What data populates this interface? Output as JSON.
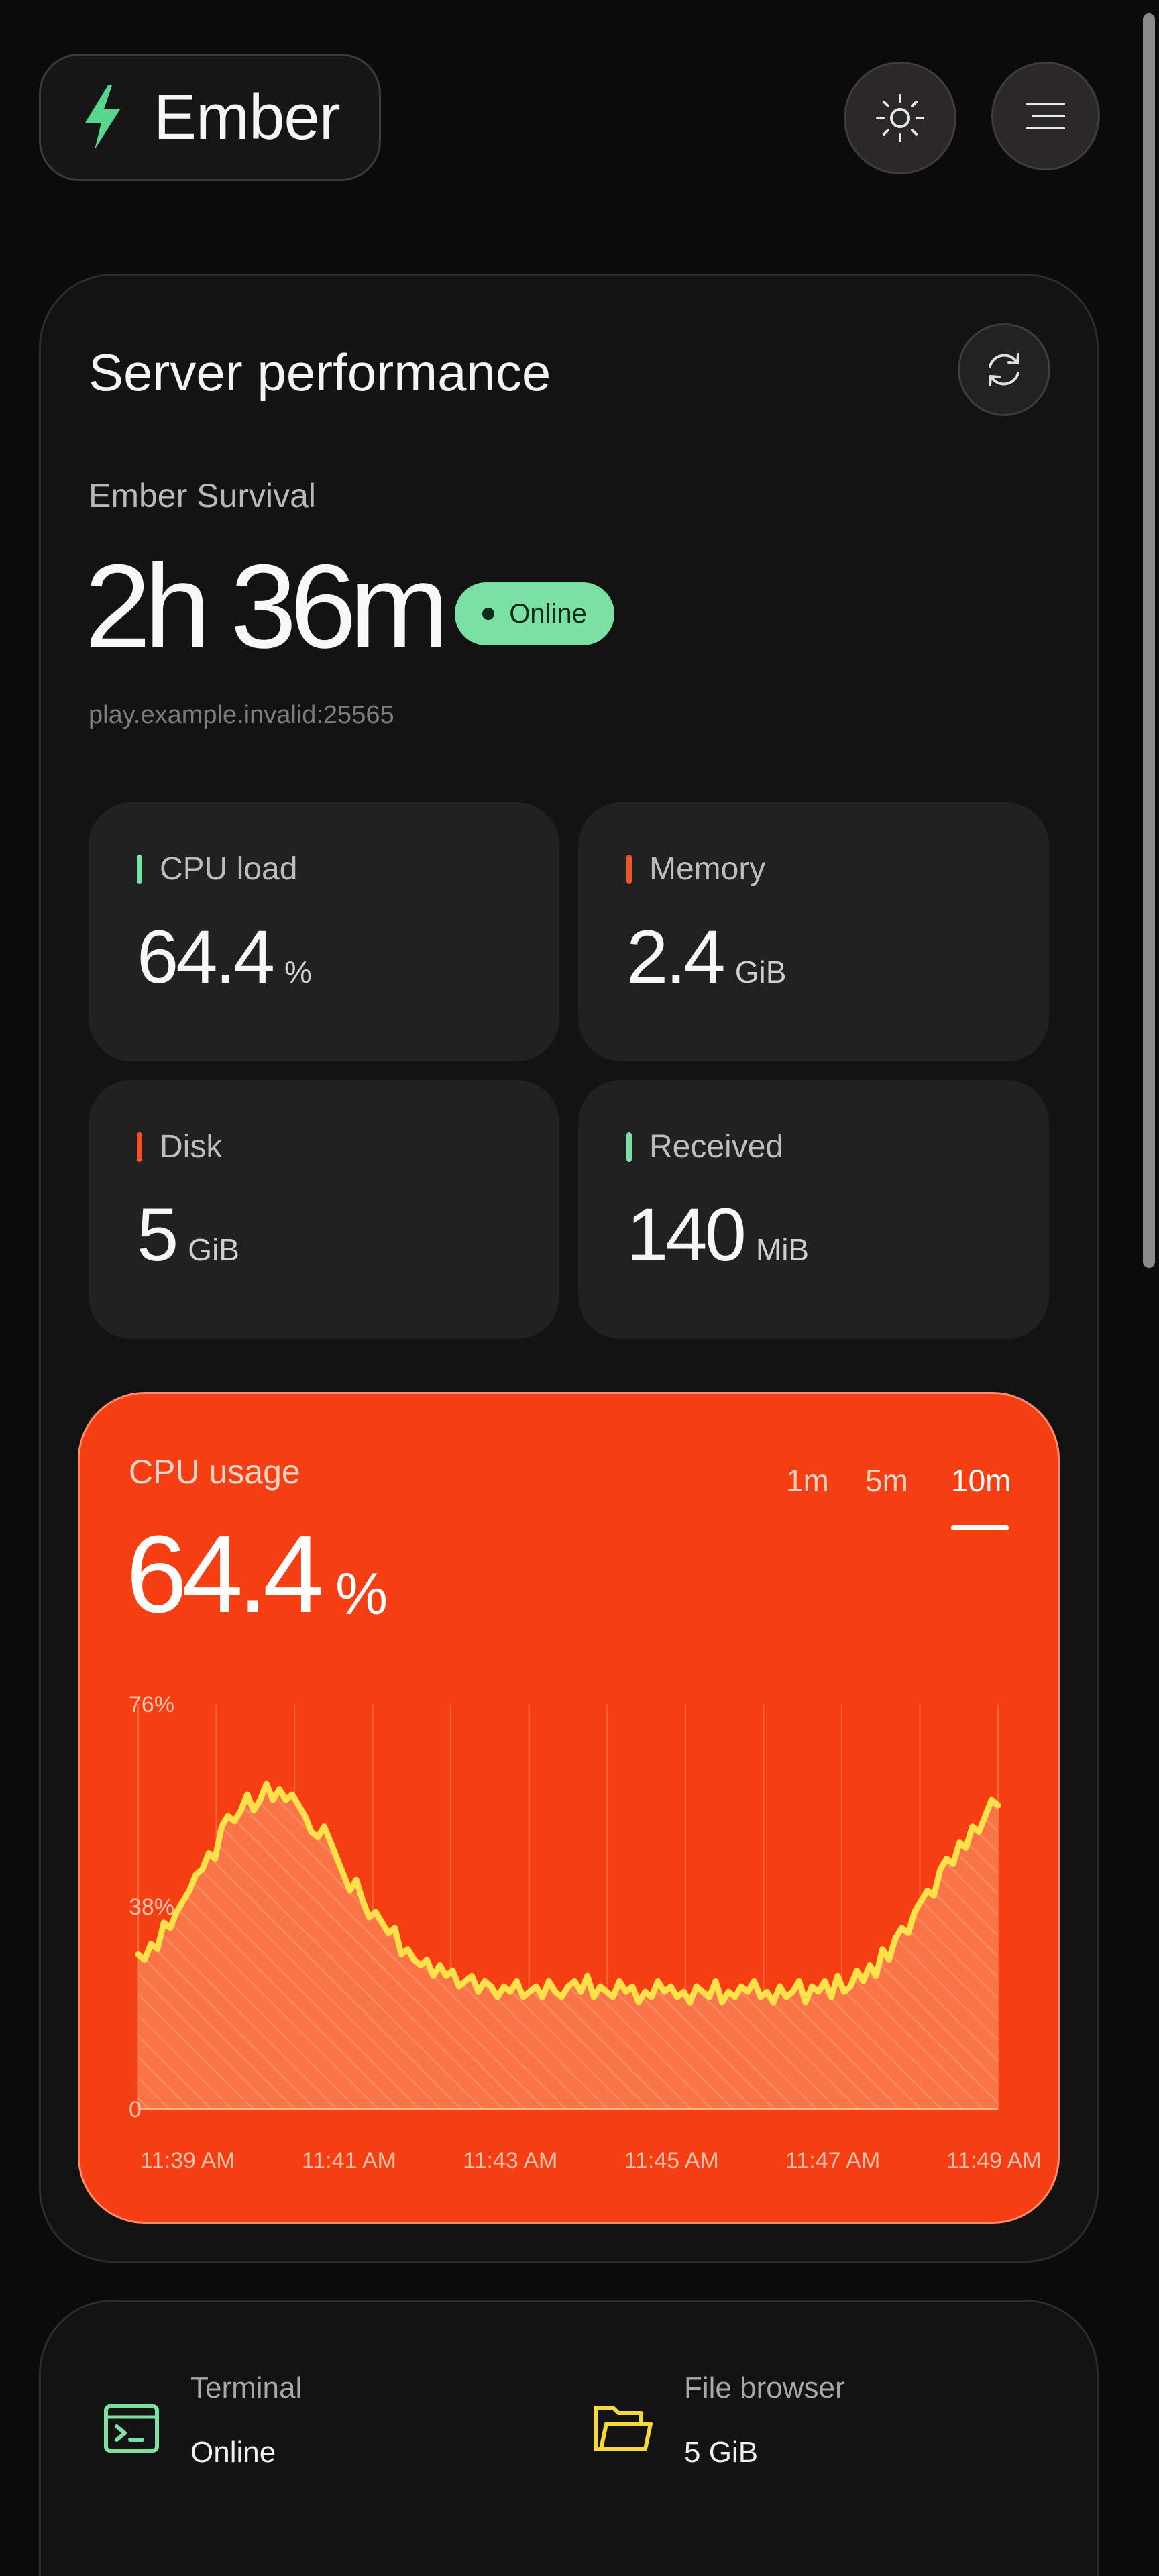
{
  "header": {
    "brand_name": "Ember",
    "theme_toggle_icon": "sun-icon",
    "menu_icon": "hamburger-icon"
  },
  "performance": {
    "title": "Server performance",
    "refresh_icon": "refresh-icon",
    "server_name": "Ember Survival",
    "uptime": "2h 36m",
    "status": "Online",
    "address": "play.example.invalid:25565",
    "stats": [
      {
        "label": "CPU load",
        "value": "64.4",
        "unit": "%",
        "accent": "#7ae0a3"
      },
      {
        "label": "Memory",
        "value": "2.4",
        "unit": "GiB",
        "accent": "#f0532a"
      },
      {
        "label": "Disk",
        "value": "5",
        "unit": "GiB",
        "accent": "#f0532a"
      },
      {
        "label": "Received",
        "value": "140",
        "unit": "MiB",
        "accent": "#7ae0a3"
      }
    ]
  },
  "cpu_chart": {
    "title": "CPU usage",
    "value": "64.4",
    "unit": "%",
    "ranges": [
      "1m",
      "5m",
      "10m"
    ],
    "selected_range": "10m",
    "background": "#f53f12",
    "line_color": "#ffe24a"
  },
  "chart_data": {
    "type": "area",
    "title": "CPU usage",
    "xlabel": "",
    "ylabel": "",
    "y_tick_labels": [
      "76%",
      "38%",
      "0"
    ],
    "ylim": [
      0,
      76
    ],
    "x_tick_labels": [
      "11:39 AM",
      "11:41 AM",
      "11:43 AM",
      "11:45 AM",
      "11:47 AM",
      "11:49 AM"
    ],
    "x_range": [
      "11:39 AM",
      "11:50 AM"
    ],
    "series": [
      {
        "values": [
          29,
          28,
          31,
          30,
          35,
          34,
          37,
          39,
          41,
          44,
          45,
          48,
          47,
          53,
          55,
          54,
          56,
          59,
          56,
          58,
          61,
          58,
          60,
          58,
          59,
          57,
          55,
          52,
          51,
          53,
          50,
          47,
          44,
          41,
          43,
          39,
          36,
          37,
          35,
          33,
          34,
          29,
          30,
          28,
          27,
          28,
          25,
          27,
          25,
          26,
          23,
          24,
          25,
          22,
          24,
          23,
          21,
          23,
          22,
          24,
          21,
          22,
          23,
          21,
          24,
          22,
          21,
          23,
          24,
          22,
          25,
          21,
          23,
          22,
          21,
          24,
          22,
          23,
          20,
          22,
          21,
          24,
          22,
          23,
          21,
          22,
          20,
          23,
          22,
          21,
          24,
          20,
          22,
          21,
          23,
          22,
          24,
          21,
          22,
          20,
          23,
          21,
          22,
          24,
          20,
          23,
          22,
          24,
          21,
          25,
          22,
          23,
          26,
          24,
          27,
          25,
          30,
          28,
          32,
          34,
          33,
          37,
          39,
          41,
          40,
          45,
          47,
          46,
          50,
          49,
          53,
          52,
          55,
          58,
          57
        ],
        "x_start": "11:39 AM",
        "x_end": "11:49 AM"
      }
    ],
    "grid": true
  },
  "services": [
    {
      "label": "Terminal",
      "value": "Online",
      "icon": "terminal-icon",
      "icon_color": "#7ae0a3"
    },
    {
      "label": "File browser",
      "value": "5 GiB",
      "icon": "folder-icon",
      "icon_color": "#f5d93a"
    }
  ]
}
